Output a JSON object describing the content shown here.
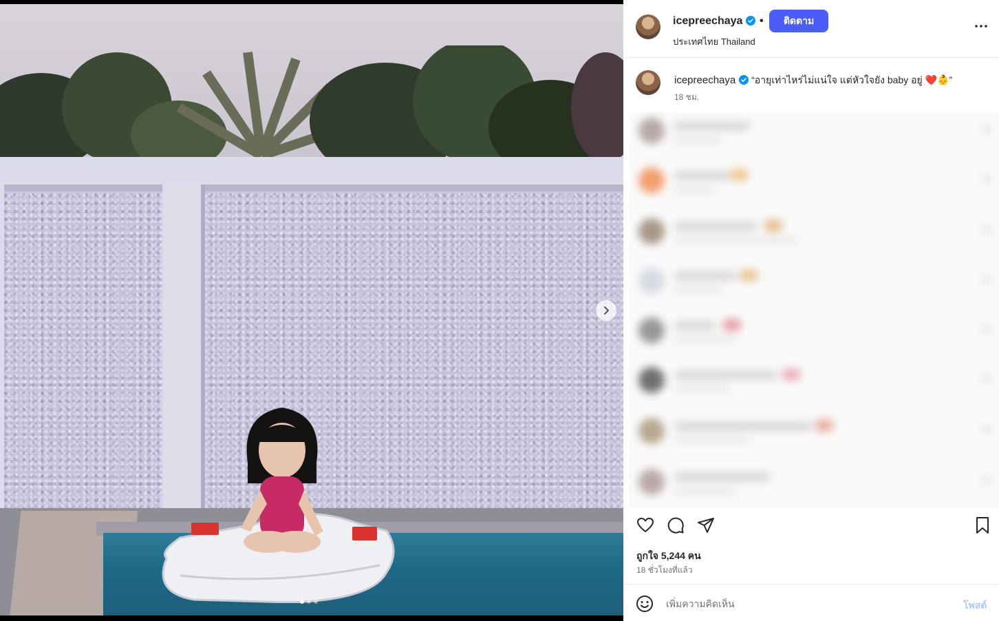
{
  "post": {
    "images_count": 3,
    "active_image": 1
  },
  "header": {
    "username": "icepreechaya",
    "separator": "•",
    "follow_label": "ติดตาม",
    "location": "ประเทศไทย Thailand"
  },
  "caption": {
    "username": "icepreechaya",
    "text": "“อายุเท่าไหร่ไม่แน่ใจ แต่หัวใจยัง baby อยู่ ❤️👶”",
    "time": "18 ชม."
  },
  "engagement": {
    "likes": "ถูกใจ 5,244 คน",
    "time_ago": "18 ชั่วโมงที่แล้ว"
  },
  "comment_box": {
    "placeholder": "เพิ่มความคิดเห็น",
    "post_label": "โพสต์"
  },
  "colors": {
    "follow_button": "#4a5df9",
    "verified_badge": "#0095f6",
    "post_button_disabled": "#b2c8f9"
  },
  "icons": [
    "chevron-right-icon",
    "verified-badge-icon",
    "more-options-icon",
    "heart-icon",
    "comment-icon",
    "share-icon",
    "bookmark-icon",
    "emoji-icon"
  ]
}
